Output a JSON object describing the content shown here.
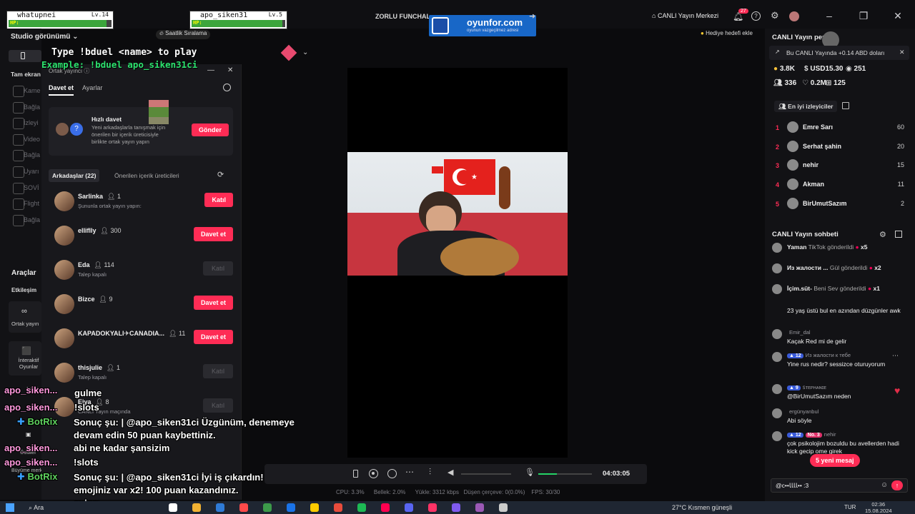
{
  "titlebar": {
    "title": "ZORLU FUNCHAL",
    "live_center": "CANLI Yayın Merkezi",
    "notif_count": "27"
  },
  "hud": [
    {
      "name": "whatupnei",
      "level": "Lv.14",
      "hp_label": "HP:",
      "hp": 0.95
    },
    {
      "name": "apo_siken31",
      "level": "Lv.5",
      "hp_label": "HP:",
      "hp": 0.97
    }
  ],
  "ad": {
    "brand": "oyunfor.com",
    "tagline": "oyunun vazgeçilmez adresi"
  },
  "topbar": {
    "hourly_rank": "Saatlik Sıralama",
    "gift_goal": "Hediye hedefi ekle"
  },
  "duel": {
    "line1": "Type !bduel <name> to play",
    "line2": "Example: !bduel apo_siken31ci"
  },
  "studio": {
    "view_label": "Studio görünümü",
    "fullscreen": "Tam ekran",
    "menu": [
      "Kame",
      "Bağla",
      "İzleyi",
      "Video",
      "Bağla",
      "Uyarı",
      "SOVİ",
      "Flight",
      "Bağla"
    ],
    "tools_title": "Araçlar",
    "etkilesim": "Etkileşim",
    "cohost_tool": "Ortak yayın",
    "interactive": "İnteraktif Oyunlar",
    "anket": "Anket",
    "oduller": "Ödüller",
    "buyume": "Büyüme merkezi"
  },
  "cohost": {
    "title": "Ortak yayıncı",
    "tabs": [
      "Davet et",
      "Ayarlar"
    ],
    "quick_title": "Hızlı davet",
    "quick_desc": "Yeni arkadaşlarla tanışmak için önerilen bir içerik üreticisiyle birlikte ortak yayın yapın",
    "quick_button": "Gönder",
    "friends_tab": "Arkadaşlar (22)",
    "suggested_tab": "Önerilen içerik üreticileri",
    "friends": [
      {
        "name": "Sarlinka",
        "count": "1",
        "sub": "Şununla ortak yayın yapın:",
        "action": "Katıl",
        "enabled": true
      },
      {
        "name": "elliflly",
        "count": "300",
        "sub": "",
        "action": "Davet et",
        "enabled": true
      },
      {
        "name": "Eda",
        "count": "114",
        "sub": "Talep kapalı",
        "action": "Katıl",
        "enabled": false
      },
      {
        "name": "Bizce",
        "count": "9",
        "sub": "",
        "action": "Davet et",
        "enabled": true
      },
      {
        "name": "KAPADOKYALI✈CANADIA...",
        "count": "11",
        "sub": "",
        "action": "Davet et",
        "enabled": true
      },
      {
        "name": "thisjulie",
        "count": "1",
        "sub": "Talep kapalı",
        "action": "Katıl",
        "enabled": false
      },
      {
        "name": "Eiya",
        "count": "8",
        "sub": "CANLI Yayın maçında",
        "action": "Katıl",
        "enabled": false
      }
    ]
  },
  "overlay_chat": [
    {
      "user": "apo_siken...",
      "text": "gulme"
    },
    {
      "user": "apo_siken...",
      "text": "!slots"
    },
    {
      "user": "BotRix",
      "text": "Sonuç şu: | @apo_siken31ci Üzgünüm, denemeye devam edin 50 puan kaybettiniz."
    },
    {
      "user": "apo_siken...",
      "text": "abi ne kadar şansizim"
    },
    {
      "user": "apo_siken...",
      "text": "!slots"
    },
    {
      "user": "BotRix",
      "text": "Sonuç şu: | @apo_siken31ci İyi iş çıkardın! İki eşit emojiniz var x2! 100 puan kazandınız."
    },
    {
      "user": "",
      "text": "şukur"
    }
  ],
  "controls": {
    "time": "04:03:05",
    "volume": 0.35
  },
  "stats": {
    "cpu": "CPU: 3.3%",
    "ram": "Bellek: 2.0%",
    "upload": "Yükle: 3312 kbps",
    "drop": "Düşen çerçeve: 0(0.0%)",
    "fps": "FPS: 30/30"
  },
  "right": {
    "live_title": "CANLI Yayın per",
    "earn_note": "Bu CANLI Yayında +0.14 ABD doları",
    "stats": [
      {
        "icon": "coin-icon",
        "value": "3.8K"
      },
      {
        "icon": "dollar-icon",
        "value": "USD15.30"
      },
      {
        "icon": "viewers-icon",
        "value": "251"
      },
      {
        "icon": "people-icon",
        "value": "336"
      },
      {
        "icon": "heart-icon",
        "value": "0.2M"
      },
      {
        "icon": "gift-icon",
        "value": "125"
      }
    ],
    "top_viewers_label": "En iyi izleyiciler",
    "ranking": [
      {
        "rank": "1",
        "name": "Emre Sarı",
        "score": "60"
      },
      {
        "rank": "2",
        "name": "Serhat şahin",
        "score": "20"
      },
      {
        "rank": "3",
        "name": "nehir",
        "score": "15"
      },
      {
        "rank": "4",
        "name": "Akman",
        "score": "11"
      },
      {
        "rank": "5",
        "name": "BirUmutSazım",
        "score": "2"
      }
    ],
    "chat_title": "CANLI Yayın sohbeti",
    "gifts": [
      {
        "user": "Yaman",
        "text": "TikTok gönderildi",
        "mult": "x5"
      },
      {
        "user": "Из жалости ...",
        "text": "Gül gönderildi",
        "mult": "x2"
      },
      {
        "user": "İçim.süt-",
        "text": "Beni Sev gönderildi",
        "mult": "x1"
      }
    ],
    "messages": [
      {
        "user": "",
        "text": "23 yaş üstü bul en azından düzgünler awk"
      },
      {
        "user": "Emir_dal",
        "text": "Kaçak Red mi de gelir"
      },
      {
        "user": "Из жалости к тебе",
        "badge": "12",
        "text": "Yine rus nedir? sessizce oturuyorum"
      },
      {
        "user": "ꜱᴛᴇᴘʜᴀɴɪᴇ",
        "badge": "9",
        "text": "@BirUmutSazım neden"
      },
      {
        "user": "ergünyanbul",
        "text": "Abi söyle"
      },
      {
        "user": "nehir",
        "badge": "12",
        "rank": "No. 3",
        "text": "çok psikolojim bozuldu bu avellerden hadi kick gecip ome girek"
      }
    ],
    "new_messages": "5 yeni mesaj",
    "input_text": "@c••ꙆꙆꙆꙆ•• :3"
  },
  "taskbar": {
    "search": "Ara",
    "weather": "27°C",
    "weather_desc": "Kısmen güneşli",
    "lang": "TUR",
    "time": "02:36",
    "date": "15.08.2024"
  }
}
